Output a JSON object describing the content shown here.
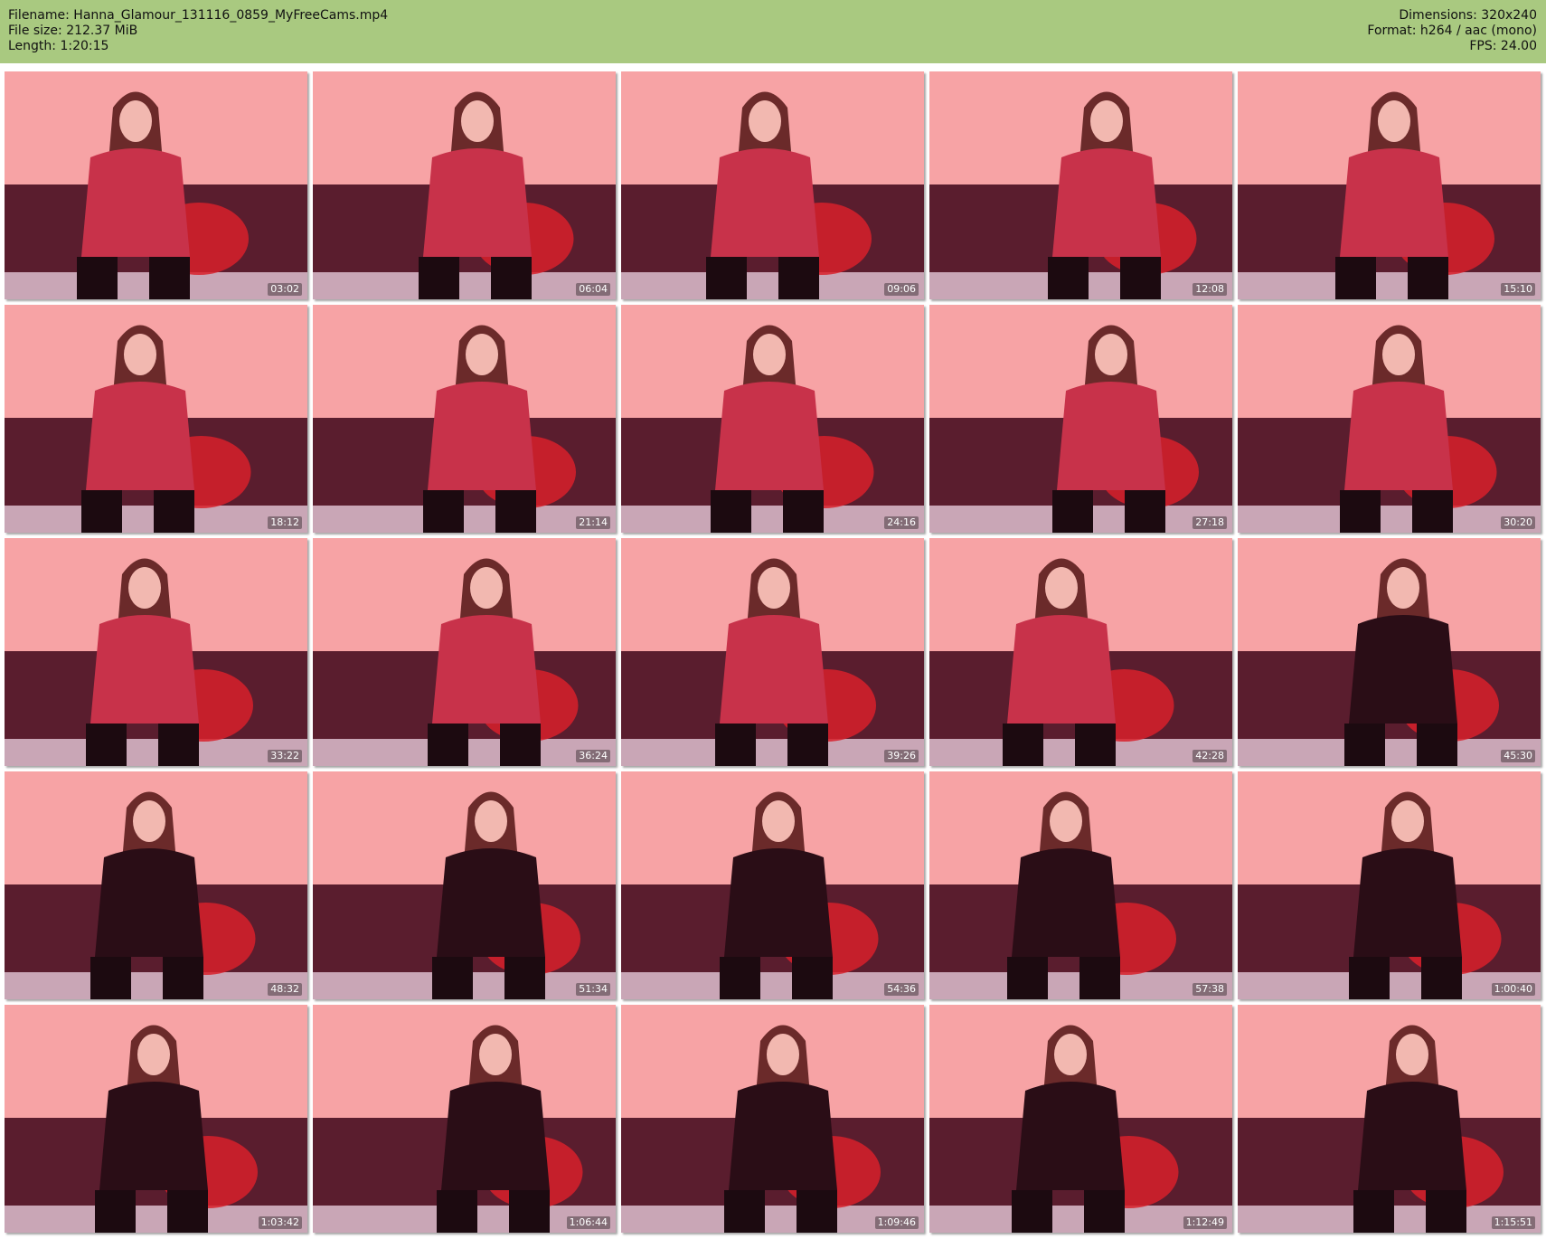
{
  "header": {
    "filename": "Filename: Hanna_Glamour_131116_0859_MyFreeCams.mp4",
    "filesize": "File size: 212.37 MiB",
    "length": "Length: 1:20:15",
    "dimensions": "Dimensions: 320x240",
    "format": "Format: h264 / aac (mono)",
    "fps": "FPS: 24.00"
  },
  "colors": {
    "header_bg": "#a9c980",
    "wall": "#f7a3a5",
    "couch": "#5a1d2e",
    "plaid": "#c8324a",
    "tee": "#2a0d16",
    "pillow": "#d8202a"
  },
  "thumbnails": [
    {
      "time": "03:02",
      "outfit": "plaid"
    },
    {
      "time": "06:04",
      "outfit": "plaid"
    },
    {
      "time": "09:06",
      "outfit": "plaid"
    },
    {
      "time": "12:08",
      "outfit": "plaid"
    },
    {
      "time": "15:10",
      "outfit": "plaid"
    },
    {
      "time": "18:12",
      "outfit": "plaid"
    },
    {
      "time": "21:14",
      "outfit": "plaid"
    },
    {
      "time": "24:16",
      "outfit": "plaid"
    },
    {
      "time": "27:18",
      "outfit": "plaid"
    },
    {
      "time": "30:20",
      "outfit": "plaid"
    },
    {
      "time": "33:22",
      "outfit": "plaid"
    },
    {
      "time": "36:24",
      "outfit": "plaid"
    },
    {
      "time": "39:26",
      "outfit": "plaid"
    },
    {
      "time": "42:28",
      "outfit": "plaid"
    },
    {
      "time": "45:30",
      "outfit": "tee"
    },
    {
      "time": "48:32",
      "outfit": "tee"
    },
    {
      "time": "51:34",
      "outfit": "tee"
    },
    {
      "time": "54:36",
      "outfit": "tee"
    },
    {
      "time": "57:38",
      "outfit": "tee"
    },
    {
      "time": "1:00:40",
      "outfit": "tee"
    },
    {
      "time": "1:03:42",
      "outfit": "tee"
    },
    {
      "time": "1:06:44",
      "outfit": "tee"
    },
    {
      "time": "1:09:46",
      "outfit": "tee"
    },
    {
      "time": "1:12:49",
      "outfit": "tee"
    },
    {
      "time": "1:15:51",
      "outfit": "tee"
    }
  ]
}
